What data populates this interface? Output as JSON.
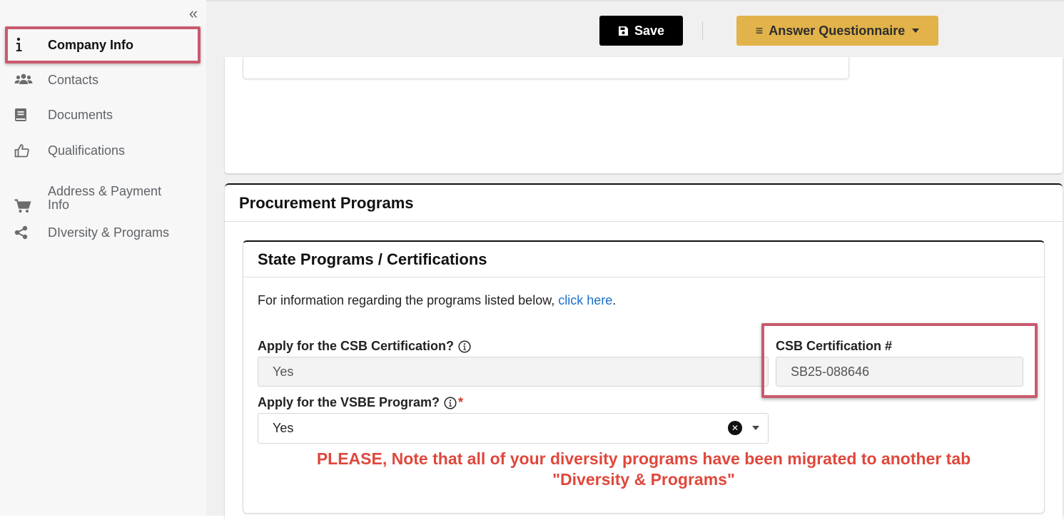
{
  "sidebar": {
    "collapse_glyph": "«",
    "items": [
      {
        "label": "Company Info",
        "icon": "info-icon",
        "active": true
      },
      {
        "label": "Contacts",
        "icon": "users-icon"
      },
      {
        "label": "Documents",
        "icon": "book-icon"
      },
      {
        "label": "Qualifications",
        "icon": "thumbs-up-icon"
      },
      {
        "label": "Address & Payment Info",
        "icon": "cart-icon"
      },
      {
        "label": "DIversity & Programs",
        "icon": "share-icon"
      }
    ]
  },
  "toolbar": {
    "save_label": "Save",
    "answer_label": "Answer Questionnaire",
    "answer_glyph": "≡"
  },
  "procurement": {
    "title": "Procurement Programs",
    "state": {
      "title": "State Programs / Certifications",
      "info_text": "For information regarding the programs listed below, ",
      "info_link": "click here",
      "info_end": ".",
      "csb_apply_label": "Apply for the CSB Certification?",
      "csb_apply_value": "Yes",
      "csb_number_label": "CSB Certification #",
      "csb_number_value": "SB25-088646",
      "vsbe_label": "Apply for the VSBE Program?",
      "vsbe_required": "*",
      "vsbe_value": "Yes",
      "note_line1": "PLEASE, Note that all of your diversity programs have been migrated to another tab",
      "note_line2": "\"Diversity & Programs\""
    }
  },
  "colors": {
    "highlight": "#c95a6e",
    "save_bg": "#000000",
    "answer_bg": "#e2b34a",
    "note": "#e0473c",
    "link": "#1a6fc9"
  }
}
